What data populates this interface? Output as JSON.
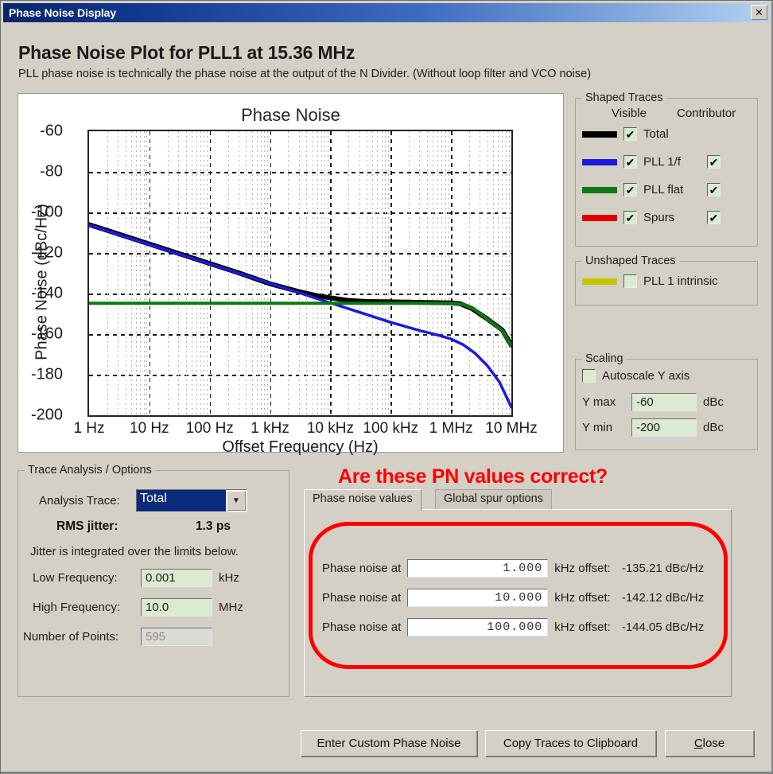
{
  "window": {
    "title": "Phase Noise Display",
    "close_icon": "close-icon",
    "close_glyph": "✕"
  },
  "header": {
    "title": "Phase Noise Plot for PLL1 at 15.36 MHz",
    "subtitle": "PLL phase noise is technically the phase noise at the output of the N Divider. (Without loop filter and VCO noise)"
  },
  "chart_data": {
    "type": "line",
    "title": "Phase Noise",
    "xlabel": "Offset Frequency (Hz)",
    "ylabel": "Phase Noise (dBc/Hz)",
    "ylim": [
      -200,
      -60
    ],
    "xlim_log10": [
      0,
      7
    ],
    "yticks": [
      -60,
      -80,
      -100,
      -120,
      -140,
      -160,
      -180,
      -200
    ],
    "ytick_labels": [
      "-60",
      "-80",
      "-100",
      "-120",
      "-140",
      "-160",
      "-180",
      "-200"
    ],
    "xticks_log10": [
      0,
      1,
      2,
      3,
      4,
      5,
      6,
      7
    ],
    "xtick_labels": [
      "1 Hz",
      "10 Hz",
      "100 Hz",
      "1 kHz",
      "10 kHz",
      "100 kHz",
      "1 MHz",
      "10 MHz"
    ],
    "grid": true,
    "legend": "external",
    "series": [
      {
        "name": "Total",
        "color": "#000000",
        "width": 6,
        "points_log10_db": [
          [
            0,
            -106.0
          ],
          [
            0.5,
            -110.8
          ],
          [
            1,
            -115.6
          ],
          [
            1.5,
            -120.4
          ],
          [
            2,
            -125.2
          ],
          [
            2.5,
            -130.0
          ],
          [
            3,
            -135.2
          ],
          [
            3.5,
            -139.2
          ],
          [
            3.8,
            -141.2
          ],
          [
            4,
            -142.1
          ],
          [
            4.3,
            -143.4
          ],
          [
            4.6,
            -143.9
          ],
          [
            5,
            -144.05
          ],
          [
            5.4,
            -144.3
          ],
          [
            5.8,
            -144.5
          ],
          [
            6.0,
            -144.6
          ],
          [
            6.15,
            -145.0
          ],
          [
            6.35,
            -147.5
          ],
          [
            6.6,
            -152.5
          ],
          [
            6.85,
            -158.0
          ],
          [
            7,
            -165.5
          ]
        ]
      },
      {
        "name": "PLL 1/f",
        "color": "#1a1ae0",
        "width": 3.5,
        "points_log10_db": [
          [
            0,
            -106.2
          ],
          [
            0.5,
            -111.0
          ],
          [
            1,
            -115.8
          ],
          [
            1.5,
            -120.6
          ],
          [
            2,
            -125.4
          ],
          [
            2.5,
            -130.2
          ],
          [
            3,
            -135.0
          ],
          [
            3.5,
            -139.8
          ],
          [
            4,
            -144.6
          ],
          [
            4.5,
            -149.4
          ],
          [
            5,
            -154.2
          ],
          [
            5.5,
            -158.4
          ],
          [
            5.8,
            -160.6
          ],
          [
            6,
            -162.4
          ],
          [
            6.2,
            -165.2
          ],
          [
            6.4,
            -169.5
          ],
          [
            6.6,
            -175.5
          ],
          [
            6.8,
            -183.5
          ],
          [
            7,
            -196.0
          ]
        ]
      },
      {
        "name": "PLL flat",
        "color": "#0a7a10",
        "width": 4,
        "points_log10_db": [
          [
            0,
            -144.8
          ],
          [
            1,
            -144.8
          ],
          [
            2,
            -144.8
          ],
          [
            3,
            -144.8
          ],
          [
            4,
            -144.8
          ],
          [
            5,
            -144.8
          ],
          [
            5.8,
            -144.8
          ],
          [
            6.05,
            -144.9
          ],
          [
            6.2,
            -145.4
          ],
          [
            6.4,
            -148.0
          ],
          [
            6.6,
            -152.6
          ],
          [
            6.85,
            -158.2
          ],
          [
            7,
            -165.8
          ]
        ]
      }
    ]
  },
  "shaped_traces": {
    "legend": "Shaped Traces",
    "col_visible": "Visible",
    "col_contributor": "Contributor",
    "rows": [
      {
        "label": "Total",
        "color": "#000000",
        "visible": true,
        "visible_glyph": "✔",
        "has_contributor": false,
        "contributor": false,
        "contributor_glyph": ""
      },
      {
        "label": "PLL 1/f",
        "color": "#1a1ae0",
        "visible": true,
        "visible_glyph": "✔",
        "has_contributor": true,
        "contributor": true,
        "contributor_glyph": "✔"
      },
      {
        "label": "PLL flat",
        "color": "#0a7a10",
        "visible": true,
        "visible_glyph": "✔",
        "has_contributor": true,
        "contributor": true,
        "contributor_glyph": "✔"
      },
      {
        "label": "Spurs",
        "color": "#e00000",
        "visible": true,
        "visible_glyph": "✔",
        "has_contributor": true,
        "contributor": true,
        "contributor_glyph": "✔"
      }
    ]
  },
  "unshaped_traces": {
    "legend": "Unshaped Traces",
    "rows": [
      {
        "label": "PLL 1 intrinsic",
        "color": "#c9c400",
        "visible": false,
        "visible_glyph": ""
      }
    ]
  },
  "scaling": {
    "legend": "Scaling",
    "autoscale_label": "Autoscale Y axis",
    "autoscale_checked": false,
    "autoscale_glyph": "",
    "ymax_label": "Y max",
    "ymax_value": "-60",
    "ymax_unit": "dBc",
    "ymin_label": "Y min",
    "ymin_value": "-200",
    "ymin_unit": "dBc"
  },
  "trace_analysis": {
    "legend": "Trace Analysis / Options",
    "analysis_trace_label": "Analysis Trace:",
    "analysis_trace_value": "Total",
    "analysis_trace_arrow": "▼",
    "rms_jitter_label": "RMS jitter:",
    "rms_jitter_value": "1.3 ps",
    "note": "Jitter is integrated over the limits below.",
    "low_freq_label": "Low Frequency:",
    "low_freq_value": "0.001",
    "low_freq_unit": "kHz",
    "high_freq_label": "High Frequency:",
    "high_freq_value": "10.0",
    "high_freq_unit": "MHz",
    "points_label": "Number of Points:",
    "points_value": "595"
  },
  "annotation": {
    "text": "Are these PN values correct?",
    "color": "#ff0000"
  },
  "tabs": [
    {
      "label": "Phase noise values",
      "active": true
    },
    {
      "label": "Global spur options",
      "active": false
    }
  ],
  "phase_noise_values": {
    "rows": [
      {
        "prefix": "Phase noise at",
        "offset": "1.000",
        "mid": "kHz offset:",
        "result": "-135.21 dBc/Hz"
      },
      {
        "prefix": "Phase noise at",
        "offset": "10.000",
        "mid": "kHz offset:",
        "result": "-142.12 dBc/Hz"
      },
      {
        "prefix": "Phase noise at",
        "offset": "100.000",
        "mid": "kHz offset:",
        "result": "-144.05 dBc/Hz"
      }
    ]
  },
  "buttons": {
    "enter_custom": "Enter Custom Phase Noise",
    "copy_traces": "Copy Traces to Clipboard",
    "close": "Close",
    "close_accel": "C",
    "close_rest": "lose"
  }
}
